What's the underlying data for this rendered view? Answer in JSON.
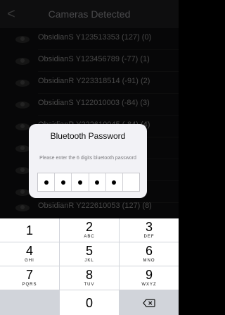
{
  "nav": {
    "back_glyph": "<",
    "title": "Cameras Detected"
  },
  "devices": [
    {
      "label": "ObsidianS Y123513353 (127) (0)"
    },
    {
      "label": "ObsidianS Y123456789 (-77) (1)"
    },
    {
      "label": "ObsidianR Y223318514 (-91) (2)"
    },
    {
      "label": "ObsidianS Y122010003 (-84) (3)"
    },
    {
      "label": "ObsidianR Y222610045 (-84) (4)"
    },
    {
      "label": ""
    },
    {
      "label": ""
    },
    {
      "label": ""
    },
    {
      "label": "ObsidianR Y222610053 (127) (8)"
    }
  ],
  "dialog": {
    "title": "Bluetooth Password",
    "message": "Please enter the 6 digits bluetooth password",
    "pin_filled": 5,
    "pin_length": 6
  },
  "keypad": {
    "keys": [
      {
        "num": "1",
        "sub": ""
      },
      {
        "num": "2",
        "sub": "ABC"
      },
      {
        "num": "3",
        "sub": "DEF"
      },
      {
        "num": "4",
        "sub": "GHI"
      },
      {
        "num": "5",
        "sub": "JKL"
      },
      {
        "num": "6",
        "sub": "MNO"
      },
      {
        "num": "7",
        "sub": "PQRS"
      },
      {
        "num": "8",
        "sub": "TUV"
      },
      {
        "num": "9",
        "sub": "WXYZ"
      },
      {
        "num": "0",
        "sub": ""
      }
    ],
    "delete_icon": "backspace-icon"
  }
}
